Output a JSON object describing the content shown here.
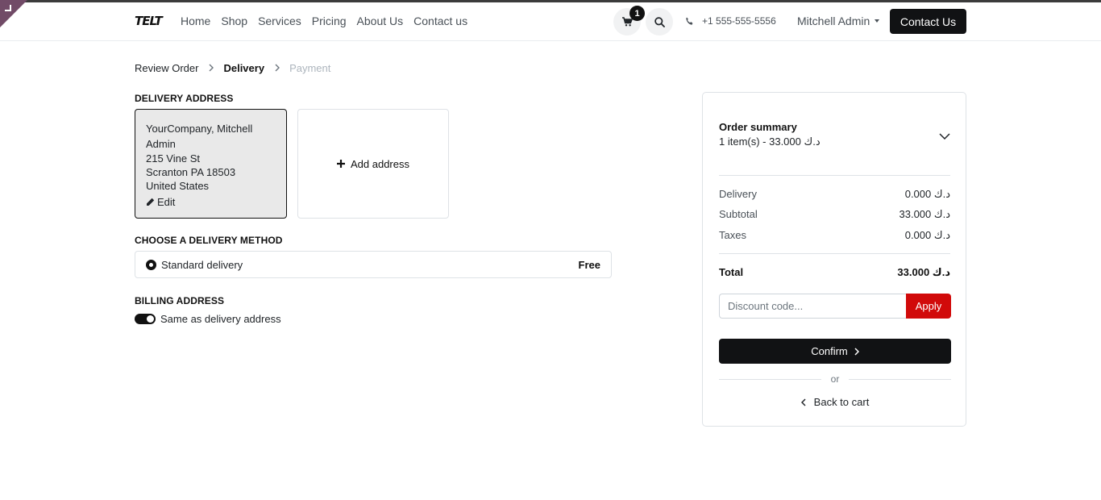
{
  "header": {
    "logo": "TELT",
    "nav": [
      "Home",
      "Shop",
      "Services",
      "Pricing",
      "About Us",
      "Contact us"
    ],
    "cart_count": "1",
    "phone": "+1 555-555-5556",
    "user": "Mitchell Admin",
    "contact_button": "Contact Us"
  },
  "breadcrumb": {
    "step1": "Review Order",
    "step2": "Delivery",
    "step3": "Payment"
  },
  "delivery_address": {
    "title": "DELIVERY ADDRESS",
    "name_line1": "YourCompany, Mitchell",
    "name_line2": "Admin",
    "street": "215 Vine St",
    "city": "Scranton PA 18503",
    "country": "United States",
    "edit_label": "Edit",
    "add_label": "Add address"
  },
  "delivery_method": {
    "title": "CHOOSE A DELIVERY METHOD",
    "option_label": "Standard delivery",
    "option_price": "Free"
  },
  "billing": {
    "title": "BILLING ADDRESS",
    "same_label": "Same as delivery address"
  },
  "summary": {
    "title": "Order summary",
    "items_text": "1 item(s) -  33.000  د.ك",
    "delivery_label": "Delivery",
    "delivery_value": "0.000  د.ك",
    "subtotal_label": "Subtotal",
    "subtotal_value": "33.000  د.ك",
    "taxes_label": "Taxes",
    "taxes_value": "0.000  د.ك",
    "total_label": "Total",
    "total_value": "33.000  د.ك",
    "discount_placeholder": "Discount code...",
    "apply_label": "Apply",
    "confirm_label": "Confirm",
    "or_label": "or",
    "back_label": "Back to cart"
  },
  "colors": {
    "accent_dark": "#111214",
    "apply_red": "#d10a0a",
    "corner_purple": "#714b67"
  }
}
